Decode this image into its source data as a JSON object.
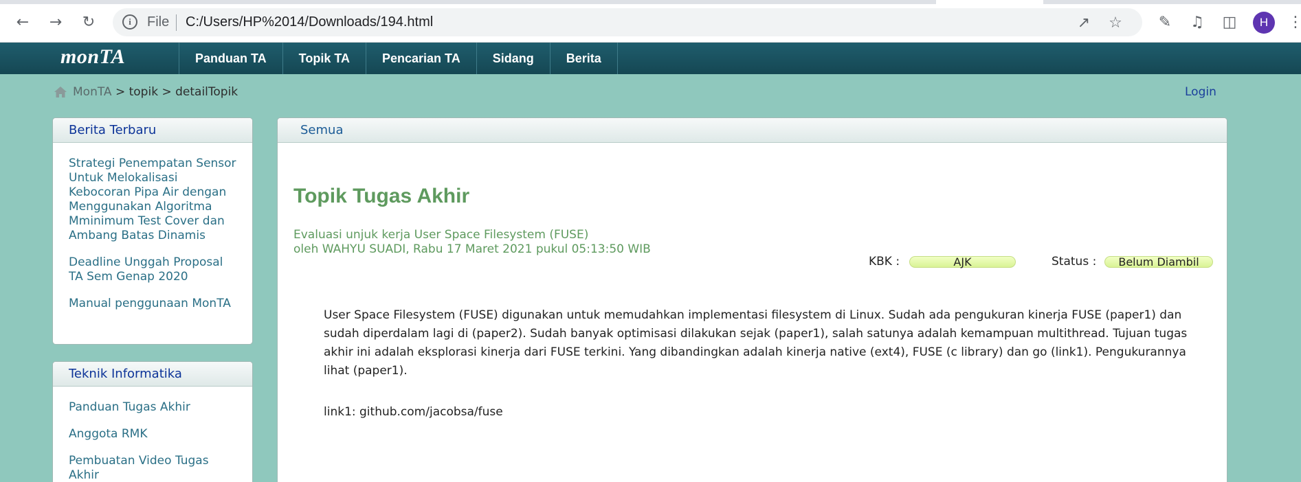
{
  "browser": {
    "file_label": "File",
    "url": "C:/Users/HP%2014/Downloads/194.html",
    "avatar_letter": "H"
  },
  "site": {
    "logo": "monTA",
    "menu": [
      "Panduan TA",
      "Topik TA",
      "Pencarian TA",
      "Sidang",
      "Berita"
    ],
    "breadcrumb": {
      "home": "MonTA",
      "sep1": " > ",
      "level1": "topik",
      "sep2": " > ",
      "level2": "detailTopik"
    },
    "login": "Login"
  },
  "sidebar": {
    "news": {
      "title": "Berita Terbaru",
      "items": [
        "Strategi Penempatan Sensor Untuk Melokalisasi Kebocoran Pipa Air dengan Menggunakan Algoritma Mminimum Test Cover dan Ambang Batas Dinamis",
        "Deadline Unggah Proposal TA Sem Genap 2020",
        "Manual penggunaan MonTA"
      ]
    },
    "dept": {
      "title": "Teknik Informatika",
      "items": [
        "Panduan Tugas Akhir",
        "Anggota RMK",
        "Pembuatan Video Tugas Akhir"
      ]
    }
  },
  "main": {
    "tab": "Semua",
    "title": "Topik Tugas Akhir",
    "subtitle_line1": "Evaluasi unjuk kerja User Space Filesystem (FUSE)",
    "subtitle_line2": "oleh WAHYU SUADI, Rabu 17 Maret 2021 pukul 05:13:50 WIB",
    "kbk_label": "KBK :",
    "kbk_value": "AJK",
    "status_label": "Status :",
    "status_value": "Belum Diambil",
    "description": "User Space Filesystem (FUSE) digunakan untuk memudahkan implementasi filesystem di Linux. Sudah ada pengukuran kinerja FUSE (paper1) dan sudah diperdalam lagi di (paper2). Sudah banyak optimisasi dilakukan sejak (paper1), salah satunya adalah kemampuan multithread. Tujuan tugas akhir ini adalah eksplorasi kinerja dari FUSE terkini. Yang dibandingkan adalah kinerja native (ext4), FUSE (c library) dan go (link1). Pengukurannya lihat (paper1).",
    "link_line": "link1: github.com/jacobsa/fuse"
  }
}
